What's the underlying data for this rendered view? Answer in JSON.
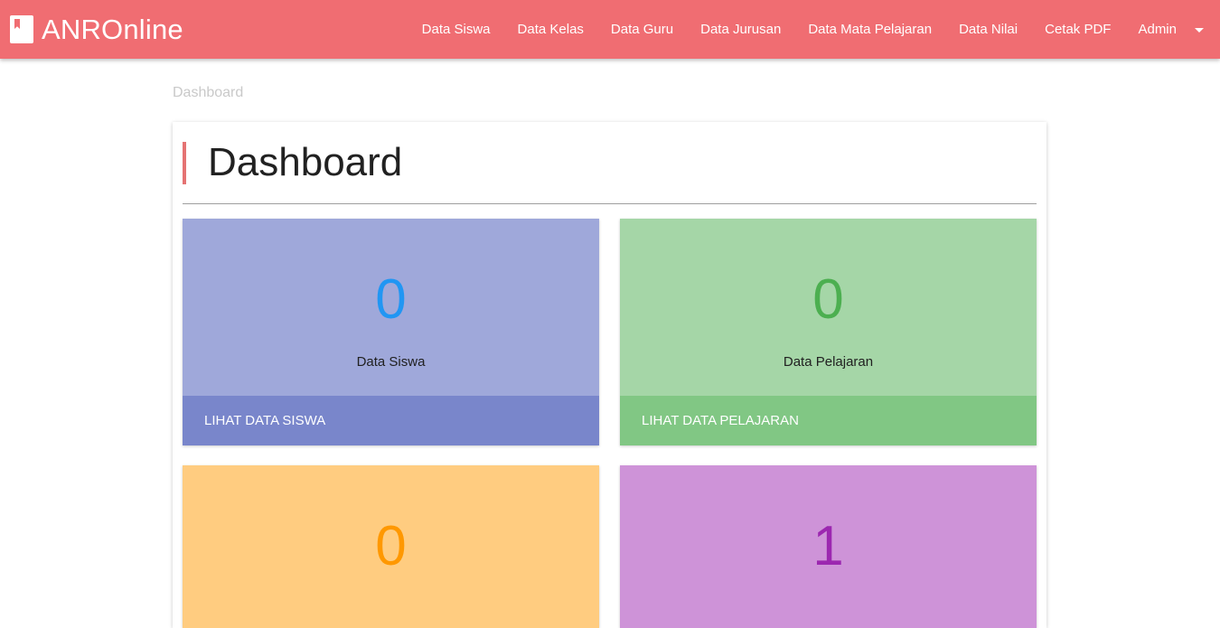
{
  "navbar": {
    "brand": "ANROnline",
    "items": [
      {
        "label": "Data Siswa"
      },
      {
        "label": "Data Kelas"
      },
      {
        "label": "Data Guru"
      },
      {
        "label": "Data Jurusan"
      },
      {
        "label": "Data Mata Pelajaran"
      },
      {
        "label": "Data Nilai"
      },
      {
        "label": "Cetak PDF"
      }
    ],
    "user_menu": "Admin"
  },
  "breadcrumb": "Dashboard",
  "main": {
    "title": "Dashboard",
    "cards": [
      {
        "value": "0",
        "label": "Data Siswa",
        "link": "LIHAT DATA SISWA"
      },
      {
        "value": "0",
        "label": "Data Pelajaran",
        "link": "LIHAT DATA PELAJARAN"
      },
      {
        "value": "0"
      },
      {
        "value": "1"
      }
    ]
  },
  "colors": {
    "navbar": "#f06d72",
    "accent_bar": "#e57373",
    "card_blue": "#9fa8da",
    "card_green": "#a5d6a7",
    "card_orange": "#ffcc80",
    "card_purple": "#ce93d8"
  }
}
